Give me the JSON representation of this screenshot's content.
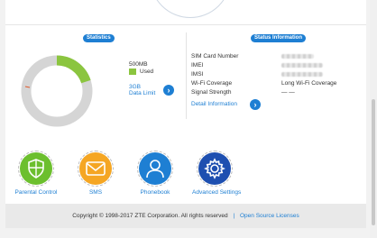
{
  "statistics": {
    "title": "Statistics",
    "donut_center": "3GB",
    "used_fraction": 0.2,
    "legend_value": "500MB",
    "legend_label": "Used",
    "limit_value": "3GB",
    "limit_label": "Data Limit",
    "colors": {
      "used": "#8bc53f",
      "remaining": "#d5d5d5",
      "marker": "#e05a2b"
    }
  },
  "status": {
    "title": "Status Information",
    "rows": [
      {
        "label": "SIM Card Number",
        "value": ""
      },
      {
        "label": "IMEI",
        "value": ""
      },
      {
        "label": "IMSI",
        "value": ""
      },
      {
        "label": "Wi-Fi Coverage",
        "value": "Long Wi-Fi Coverage"
      },
      {
        "label": "Signal Strength",
        "value": "— —"
      }
    ],
    "detail_link": "Detail Information"
  },
  "apps": [
    {
      "label": "Parental Control",
      "icon": "shield-icon",
      "color": "#6cbf2e"
    },
    {
      "label": "SMS",
      "icon": "envelope-icon",
      "color": "#f5a623"
    },
    {
      "label": "Phonebook",
      "icon": "person-icon",
      "color": "#1e7fd3"
    },
    {
      "label": "Advanced Settings",
      "icon": "gear-icon",
      "color": "#1e4fb0"
    }
  ],
  "footer": {
    "copyright": "Copyright © 1998-2017 ZTE Corporation. All rights reserved",
    "separator": "|",
    "link": "Open Source Licenses"
  }
}
